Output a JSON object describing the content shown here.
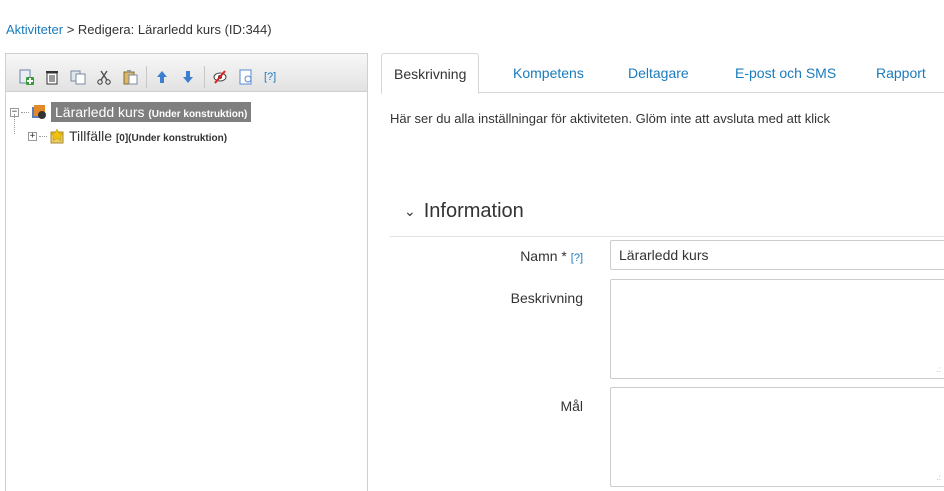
{
  "breadcrumb": {
    "link": "Aktiviteter",
    "separator": " > ",
    "current": "Redigera: Lärarledd kurs (ID:344)"
  },
  "toolbar": {
    "help_label": "[?]",
    "buttons": [
      "add-icon",
      "delete-icon",
      "copy-icon",
      "cut-icon",
      "paste-icon",
      "move-up-icon",
      "move-down-icon",
      "hide-icon",
      "preview-icon"
    ]
  },
  "tree": {
    "root": {
      "label": "Lärarledd kurs",
      "status": "(Under konstruktion)",
      "expander": "−"
    },
    "child": {
      "label": "Tillfälle",
      "status": "[0](Under konstruktion)",
      "expander": "+"
    }
  },
  "tabs": [
    "Beskrivning",
    "Kompetens",
    "Deltagare",
    "E-post och SMS",
    "Rapport"
  ],
  "intro_text": "Här ser du alla inställningar för aktiviteten. Glöm inte att avsluta med att klick",
  "section": {
    "title": "Information",
    "chevron": "⌄"
  },
  "form": {
    "name_label": "Namn *",
    "name_help": "[?]",
    "name_value": "Lärarledd kurs",
    "description_label": "Beskrivning",
    "goal_label": "Mål"
  },
  "colors": {
    "link": "#1a7bbd",
    "selected_node": "#7f7f7f"
  }
}
